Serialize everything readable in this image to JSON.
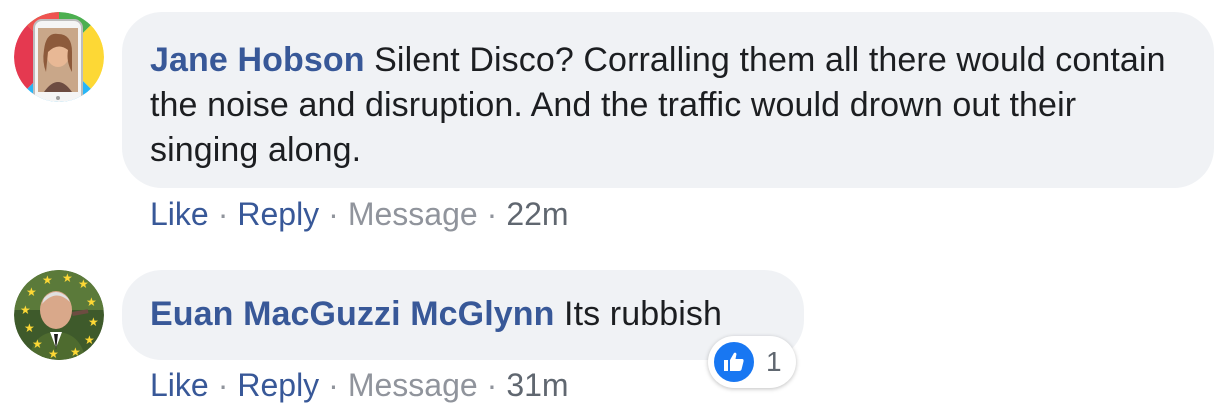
{
  "comments": [
    {
      "author": "Jane Hobson",
      "text": "Silent Disco? Corralling them all there would contain the noise and disruption. And the traffic would drown out their singing along.",
      "actions": {
        "like": "Like",
        "reply": "Reply",
        "message": "Message",
        "time": "22m",
        "separator": "·"
      }
    },
    {
      "author": "Euan MacGuzzi McGlynn",
      "text": "Its rubbish",
      "actions": {
        "like": "Like",
        "reply": "Reply",
        "message": "Message",
        "time": "31m",
        "separator": "·"
      },
      "reaction": {
        "icon": "thumbs-up-icon",
        "count": "1"
      }
    }
  ],
  "colors": {
    "author_link": "#385898",
    "bubble_bg": "#f0f2f5",
    "like_blue": "#1877f2",
    "muted": "#90949c"
  }
}
